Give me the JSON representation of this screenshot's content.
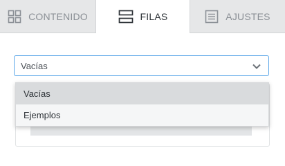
{
  "tabs": [
    {
      "label": "CONTENIDO",
      "icon": "grid-icon",
      "active": false
    },
    {
      "label": "FILAS",
      "icon": "rows-icon",
      "active": true
    },
    {
      "label": "AJUSTES",
      "icon": "settings-list-icon",
      "active": false
    }
  ],
  "select": {
    "value": "Vacías",
    "options": [
      "Vacías",
      "Ejemplos"
    ],
    "selected_index": 0
  },
  "colors": {
    "accent": "#5aa6e8",
    "tab_bg": "#e6e7e8",
    "active_tab_bg": "#ffffff",
    "selected_option_bg": "#d9dbdd"
  }
}
